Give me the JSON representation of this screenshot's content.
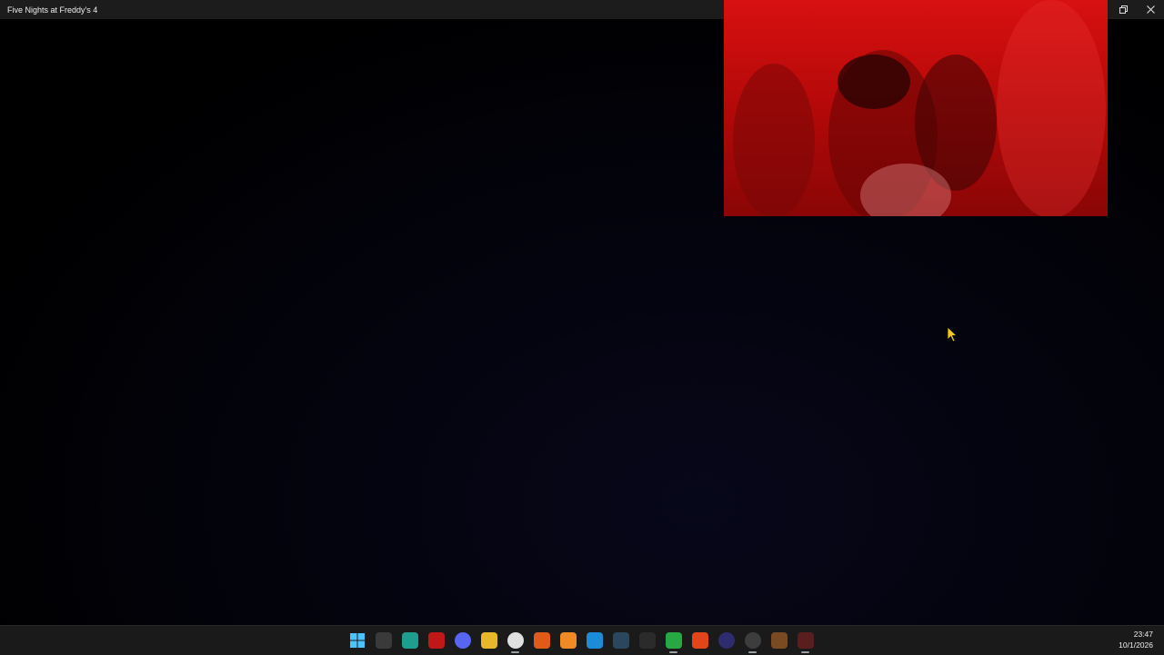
{
  "window": {
    "title": "Five Nights at Freddy's 4"
  },
  "taskbar": {
    "icons": [
      {
        "name": "start-icon",
        "color": "#2b8ae6"
      },
      {
        "name": "camera-app-icon",
        "color": "#3a3a3a"
      },
      {
        "name": "surfshark-icon",
        "color": "#1e9e8f"
      },
      {
        "name": "red-app-icon",
        "color": "#c01818"
      },
      {
        "name": "discord-icon",
        "color": "#5865f2"
      },
      {
        "name": "file-explorer-icon",
        "color": "#e8b72c"
      },
      {
        "name": "chrome-icon",
        "color": "#e0e0e0"
      },
      {
        "name": "origin-icon",
        "color": "#e05a1a"
      },
      {
        "name": "fl-studio-icon",
        "color": "#f08a24"
      },
      {
        "name": "battlenet-icon",
        "color": "#1a8cd8"
      },
      {
        "name": "steam-icon",
        "color": "#2a475e"
      },
      {
        "name": "epic-games-icon",
        "color": "#2b2b2b"
      },
      {
        "name": "xbox-icon",
        "color": "#27a843"
      },
      {
        "name": "ea-app-icon",
        "color": "#e0461a"
      },
      {
        "name": "obs-icon",
        "color": "#2e2b6e"
      },
      {
        "name": "github-icon",
        "color": "#3d3d3d"
      },
      {
        "name": "freddy-icon",
        "color": "#7a4a22"
      },
      {
        "name": "fnaf4-icon",
        "color": "#5a1e1e"
      }
    ],
    "time": "23:47",
    "date": "10/1/2026"
  }
}
